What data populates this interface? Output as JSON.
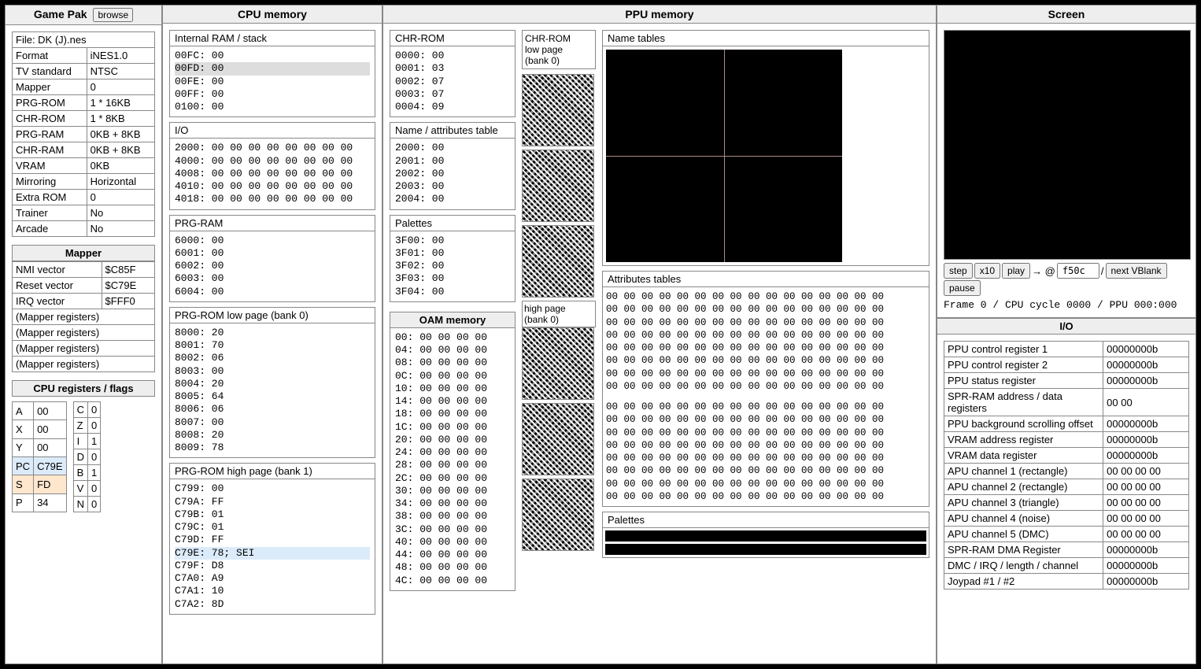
{
  "headers": {
    "gamepak": "Game Pak",
    "browse": "browse",
    "cpu_mem": "CPU memory",
    "ppu_mem": "PPU memory",
    "screen": "Screen",
    "oam": "OAM memory",
    "io": "I/O"
  },
  "file_line": "File: DK (J).nes",
  "gamepak_rows": [
    [
      "Format",
      "iNES1.0"
    ],
    [
      "TV standard",
      "NTSC"
    ],
    [
      "Mapper",
      "0"
    ],
    [
      "PRG-ROM",
      "1 * 16KB"
    ],
    [
      "CHR-ROM",
      "1 * 8KB"
    ],
    [
      "PRG-RAM",
      "0KB + 8KB"
    ],
    [
      "CHR-RAM",
      "0KB + 8KB"
    ],
    [
      "VRAM",
      "0KB"
    ],
    [
      "Mirroring",
      "Horizontal"
    ],
    [
      "Extra ROM",
      "0"
    ],
    [
      "Trainer",
      "No"
    ],
    [
      "Arcade",
      "No"
    ]
  ],
  "mapper_title": "Mapper",
  "mapper_rows": [
    [
      "NMI vector",
      "$C85F"
    ],
    [
      "Reset vector",
      "$C79E"
    ],
    [
      "IRQ vector",
      "$FFF0"
    ],
    [
      "(Mapper registers)",
      ""
    ],
    [
      "(Mapper registers)",
      ""
    ],
    [
      "(Mapper registers)",
      ""
    ],
    [
      "(Mapper registers)",
      ""
    ]
  ],
  "cpu_reg_title": "CPU registers / flags",
  "regs_left": [
    [
      "A",
      "00",
      ""
    ],
    [
      "X",
      "00",
      ""
    ],
    [
      "Y",
      "00",
      ""
    ],
    [
      "PC",
      "C79E",
      "hl-blue"
    ],
    [
      "S",
      "FD",
      "hl-orange"
    ],
    [
      "P",
      "34",
      ""
    ]
  ],
  "flags_right": [
    [
      "C",
      "0"
    ],
    [
      "Z",
      "0"
    ],
    [
      "I",
      "1"
    ],
    [
      "D",
      "0"
    ],
    [
      "B",
      "1"
    ],
    [
      "V",
      "0"
    ],
    [
      "N",
      "0"
    ]
  ],
  "cpu_sections": [
    {
      "title": "Internal RAM / stack",
      "lines": [
        {
          "t": "00FC: 00"
        },
        {
          "t": "00FD: 00",
          "cls": "hl-gray"
        },
        {
          "t": "00FE: 00"
        },
        {
          "t": "00FF: 00"
        },
        {
          "t": "0100: 00"
        }
      ]
    },
    {
      "title": "I/O",
      "lines": [
        {
          "t": "2000: 00 00 00 00 00 00 00 00"
        },
        {
          "t": "4000: 00 00 00 00 00 00 00 00"
        },
        {
          "t": "4008: 00 00 00 00 00 00 00 00"
        },
        {
          "t": "4010: 00 00 00 00 00 00 00 00"
        },
        {
          "t": "4018: 00 00 00 00 00 00 00 00"
        }
      ]
    },
    {
      "title": "PRG-RAM",
      "lines": [
        {
          "t": "6000: 00"
        },
        {
          "t": "6001: 00"
        },
        {
          "t": "6002: 00"
        },
        {
          "t": "6003: 00"
        },
        {
          "t": "6004: 00"
        }
      ]
    },
    {
      "title": "PRG-ROM low page (bank 0)",
      "lines": [
        {
          "t": "8000: 20"
        },
        {
          "t": "8001: 70"
        },
        {
          "t": "8002: 06"
        },
        {
          "t": "8003: 00"
        },
        {
          "t": "8004: 20"
        },
        {
          "t": "8005: 64"
        },
        {
          "t": "8006: 06"
        },
        {
          "t": "8007: 00"
        },
        {
          "t": "8008: 20"
        },
        {
          "t": "8009: 78"
        }
      ]
    },
    {
      "title": "PRG-ROM high page (bank 1)",
      "lines": [
        {
          "t": "C799: 00"
        },
        {
          "t": "C79A: FF"
        },
        {
          "t": "C79B: 01"
        },
        {
          "t": "C79C: 01"
        },
        {
          "t": "C79D: FF"
        },
        {
          "t": "C79E: 78; SEI",
          "cls": "hl-blue"
        },
        {
          "t": "C79F: D8"
        },
        {
          "t": "C7A0: A9"
        },
        {
          "t": "C7A1: 10"
        },
        {
          "t": "C7A2: 8D"
        }
      ]
    }
  ],
  "ppu_chr": {
    "title": "CHR-ROM",
    "lines": [
      "0000: 00",
      "0001: 03",
      "0002: 07",
      "0003: 07",
      "0004: 09"
    ]
  },
  "ppu_nat": {
    "title": "Name / attributes table",
    "lines": [
      "2000: 00",
      "2001: 00",
      "2002: 00",
      "2003: 00",
      "2004: 00"
    ]
  },
  "ppu_pal": {
    "title": "Palettes",
    "lines": [
      "3F00: 00",
      "3F01: 00",
      "3F02: 00",
      "3F03: 00",
      "3F04: 00"
    ]
  },
  "chr_low_label": "CHR-ROM\nlow page\n(bank 0)",
  "chr_high_label": "high page\n(bank 0)",
  "nt_title": "Name tables",
  "attr_title": "Attributes tables",
  "attr_block": "00 00 00 00 00 00 00 00\n00 00 00 00 00 00 00 00\n00 00 00 00 00 00 00 00\n00 00 00 00 00 00 00 00\n00 00 00 00 00 00 00 00\n00 00 00 00 00 00 00 00\n00 00 00 00 00 00 00 00\n00 00 00 00 00 00 00 00",
  "pal_title": "Palettes",
  "oam_lines": [
    "00: 00 00 00 00",
    "04: 00 00 00 00",
    "08: 00 00 00 00",
    "0C: 00 00 00 00",
    "10: 00 00 00 00",
    "14: 00 00 00 00",
    "18: 00 00 00 00",
    "1C: 00 00 00 00",
    "20: 00 00 00 00",
    "24: 00 00 00 00",
    "28: 00 00 00 00",
    "2C: 00 00 00 00",
    "30: 00 00 00 00",
    "34: 00 00 00 00",
    "38: 00 00 00 00",
    "3C: 00 00 00 00",
    "40: 00 00 00 00",
    "44: 00 00 00 00",
    "48: 00 00 00 00",
    "4C: 00 00 00 00"
  ],
  "ctrl": {
    "step": "step",
    "x10": "x10",
    "play": "play",
    "arrow": "→ @",
    "addr": "f50c",
    "slash": "/",
    "next_vblank": "next VBlank",
    "pause": "pause"
  },
  "status_line": "Frame 0 / CPU cycle 0000 / PPU 000:000",
  "io_rows": [
    [
      "PPU control register 1",
      "00000000b"
    ],
    [
      "PPU control register 2",
      "00000000b"
    ],
    [
      "PPU status register",
      "00000000b"
    ],
    [
      "SPR-RAM address / data registers",
      "00 00"
    ],
    [
      "PPU background scrolling offset",
      "00000000b"
    ],
    [
      "VRAM address register",
      "00000000b"
    ],
    [
      "VRAM data register",
      "00000000b"
    ],
    [
      "APU channel 1 (rectangle)",
      "00 00 00 00"
    ],
    [
      "APU channel 2 (rectangle)",
      "00 00 00 00"
    ],
    [
      "APU channel 3 (triangle)",
      "00 00 00 00"
    ],
    [
      "APU channel 4 (noise)",
      "00 00 00 00"
    ],
    [
      "APU channel 5 (DMC)",
      "00 00 00 00"
    ],
    [
      "SPR-RAM DMA Register",
      "00000000b"
    ],
    [
      "DMC / IRQ / length / channel",
      "00000000b"
    ],
    [
      "Joypad #1 / #2",
      "00000000b"
    ]
  ]
}
